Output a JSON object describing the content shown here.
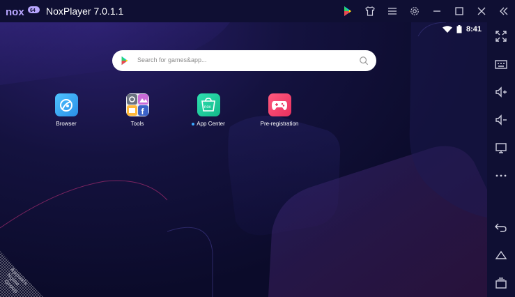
{
  "window": {
    "title": "NoxPlayer 7.0.1.1",
    "logo_text": "nox",
    "logo_badge": "64"
  },
  "titlebar_icons": [
    "google-play-icon",
    "theme-shirt-icon",
    "menu-icon",
    "settings-icon",
    "minimize-icon",
    "maximize-icon",
    "close-icon",
    "collapse-sidebar-icon"
  ],
  "status": {
    "time": "8:41"
  },
  "search": {
    "placeholder": "Search for games&app..."
  },
  "apps": [
    {
      "label": "Browser",
      "icon": "browser-icon"
    },
    {
      "label": "Tools",
      "icon": "tools-folder-icon"
    },
    {
      "label": "App Center",
      "icon": "app-center-icon"
    },
    {
      "label": "Pre-registration",
      "icon": "pre-registration-icon"
    }
  ],
  "watermark": {
    "lines": [
      "Appuals",
      "Ngine",
      "Group"
    ]
  },
  "sidebar_icons": [
    "fullscreen-icon",
    "keyboard-icon",
    "volume-up-icon",
    "volume-down-icon",
    "screen-icon",
    "more-icon",
    "back-icon",
    "home-icon",
    "recent-apps-icon"
  ],
  "colors": {
    "titlebar_bg": "#0f0f33",
    "screen_bg": "#0b0b2a",
    "accent_purple": "#6b4bd6",
    "browser_icon": "#3ab0f5",
    "app_center_icon": "#1fd1a0",
    "pre_registration_icon": "#f0446d"
  }
}
